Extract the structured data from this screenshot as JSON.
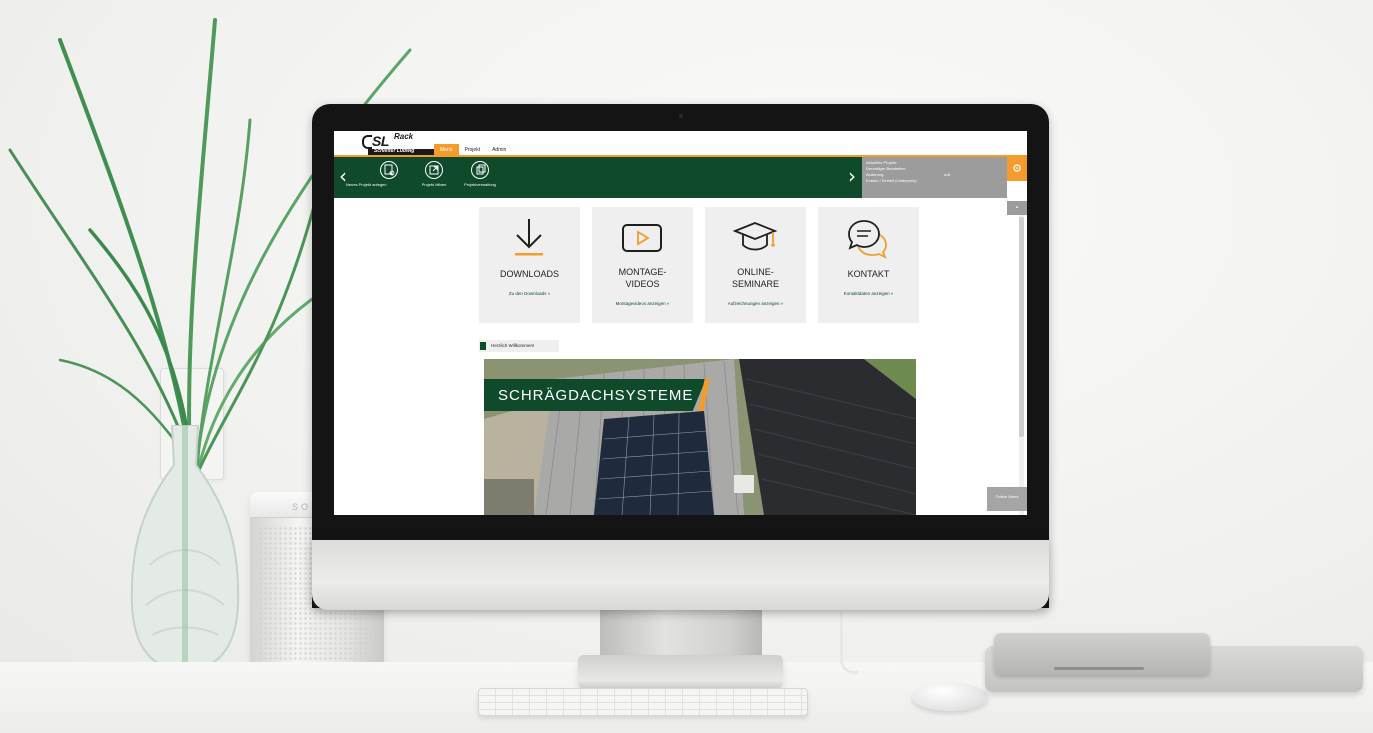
{
  "logo": {
    "brand_main": "SL",
    "brand_suffix": "Rack",
    "brand_sub": "Schletter Ludwig"
  },
  "speaker_brand": "SO",
  "nav_tabs": [
    {
      "label": "Menü",
      "active": true
    },
    {
      "label": "Projekt",
      "active": false
    },
    {
      "label": "Admin",
      "active": false
    }
  ],
  "toolbar": {
    "prev_glyph": "‹",
    "next_glyph": "›",
    "buttons": [
      {
        "label": "Neues Projekt anlegen",
        "icon": "new-project-icon"
      },
      {
        "label": "Projekt öffnen",
        "icon": "open-project-icon"
      },
      {
        "label": "Projektverwaltung",
        "icon": "project-management-icon"
      }
    ]
  },
  "project_info": {
    "rows": [
      {
        "key": "Aktuelles Projekt:",
        "value": ""
      },
      {
        "key": "Derzeitiger Bearbeiter:",
        "value": ""
      },
      {
        "key": "Änderung:",
        "value": "null"
      },
      {
        "key": "Kosten / Einheit (Lieferpreis):",
        "value": ""
      }
    ]
  },
  "settings_icon": "gear-icon",
  "online_users_label": "Online Users",
  "cards": [
    {
      "title_line1": "DOWNLOADS",
      "title_line2": "",
      "link": "Zu den Downloads »",
      "icon": "download-icon"
    },
    {
      "title_line1": "MONTAGE-",
      "title_line2": "VIDEOS",
      "link": "Montagevideos anzeigen »",
      "icon": "video-play-icon"
    },
    {
      "title_line1": "ONLINE-",
      "title_line2": "SEMINARE",
      "link": "Aufzeichnungen anzeigen »",
      "icon": "graduation-cap-icon"
    },
    {
      "title_line1": "KONTAKT",
      "title_line2": "",
      "link": "Kontaktdaten anzeigen »",
      "icon": "chat-bubbles-icon"
    }
  ],
  "welcome": "Herzlich Willkommen!",
  "hero": {
    "title": "SCHRÄGDACHSYSTEME"
  },
  "colors": {
    "brand_green": "#0f4a2a",
    "accent_orange": "#f39c2c",
    "panel_gray": "#9c9c9c"
  }
}
